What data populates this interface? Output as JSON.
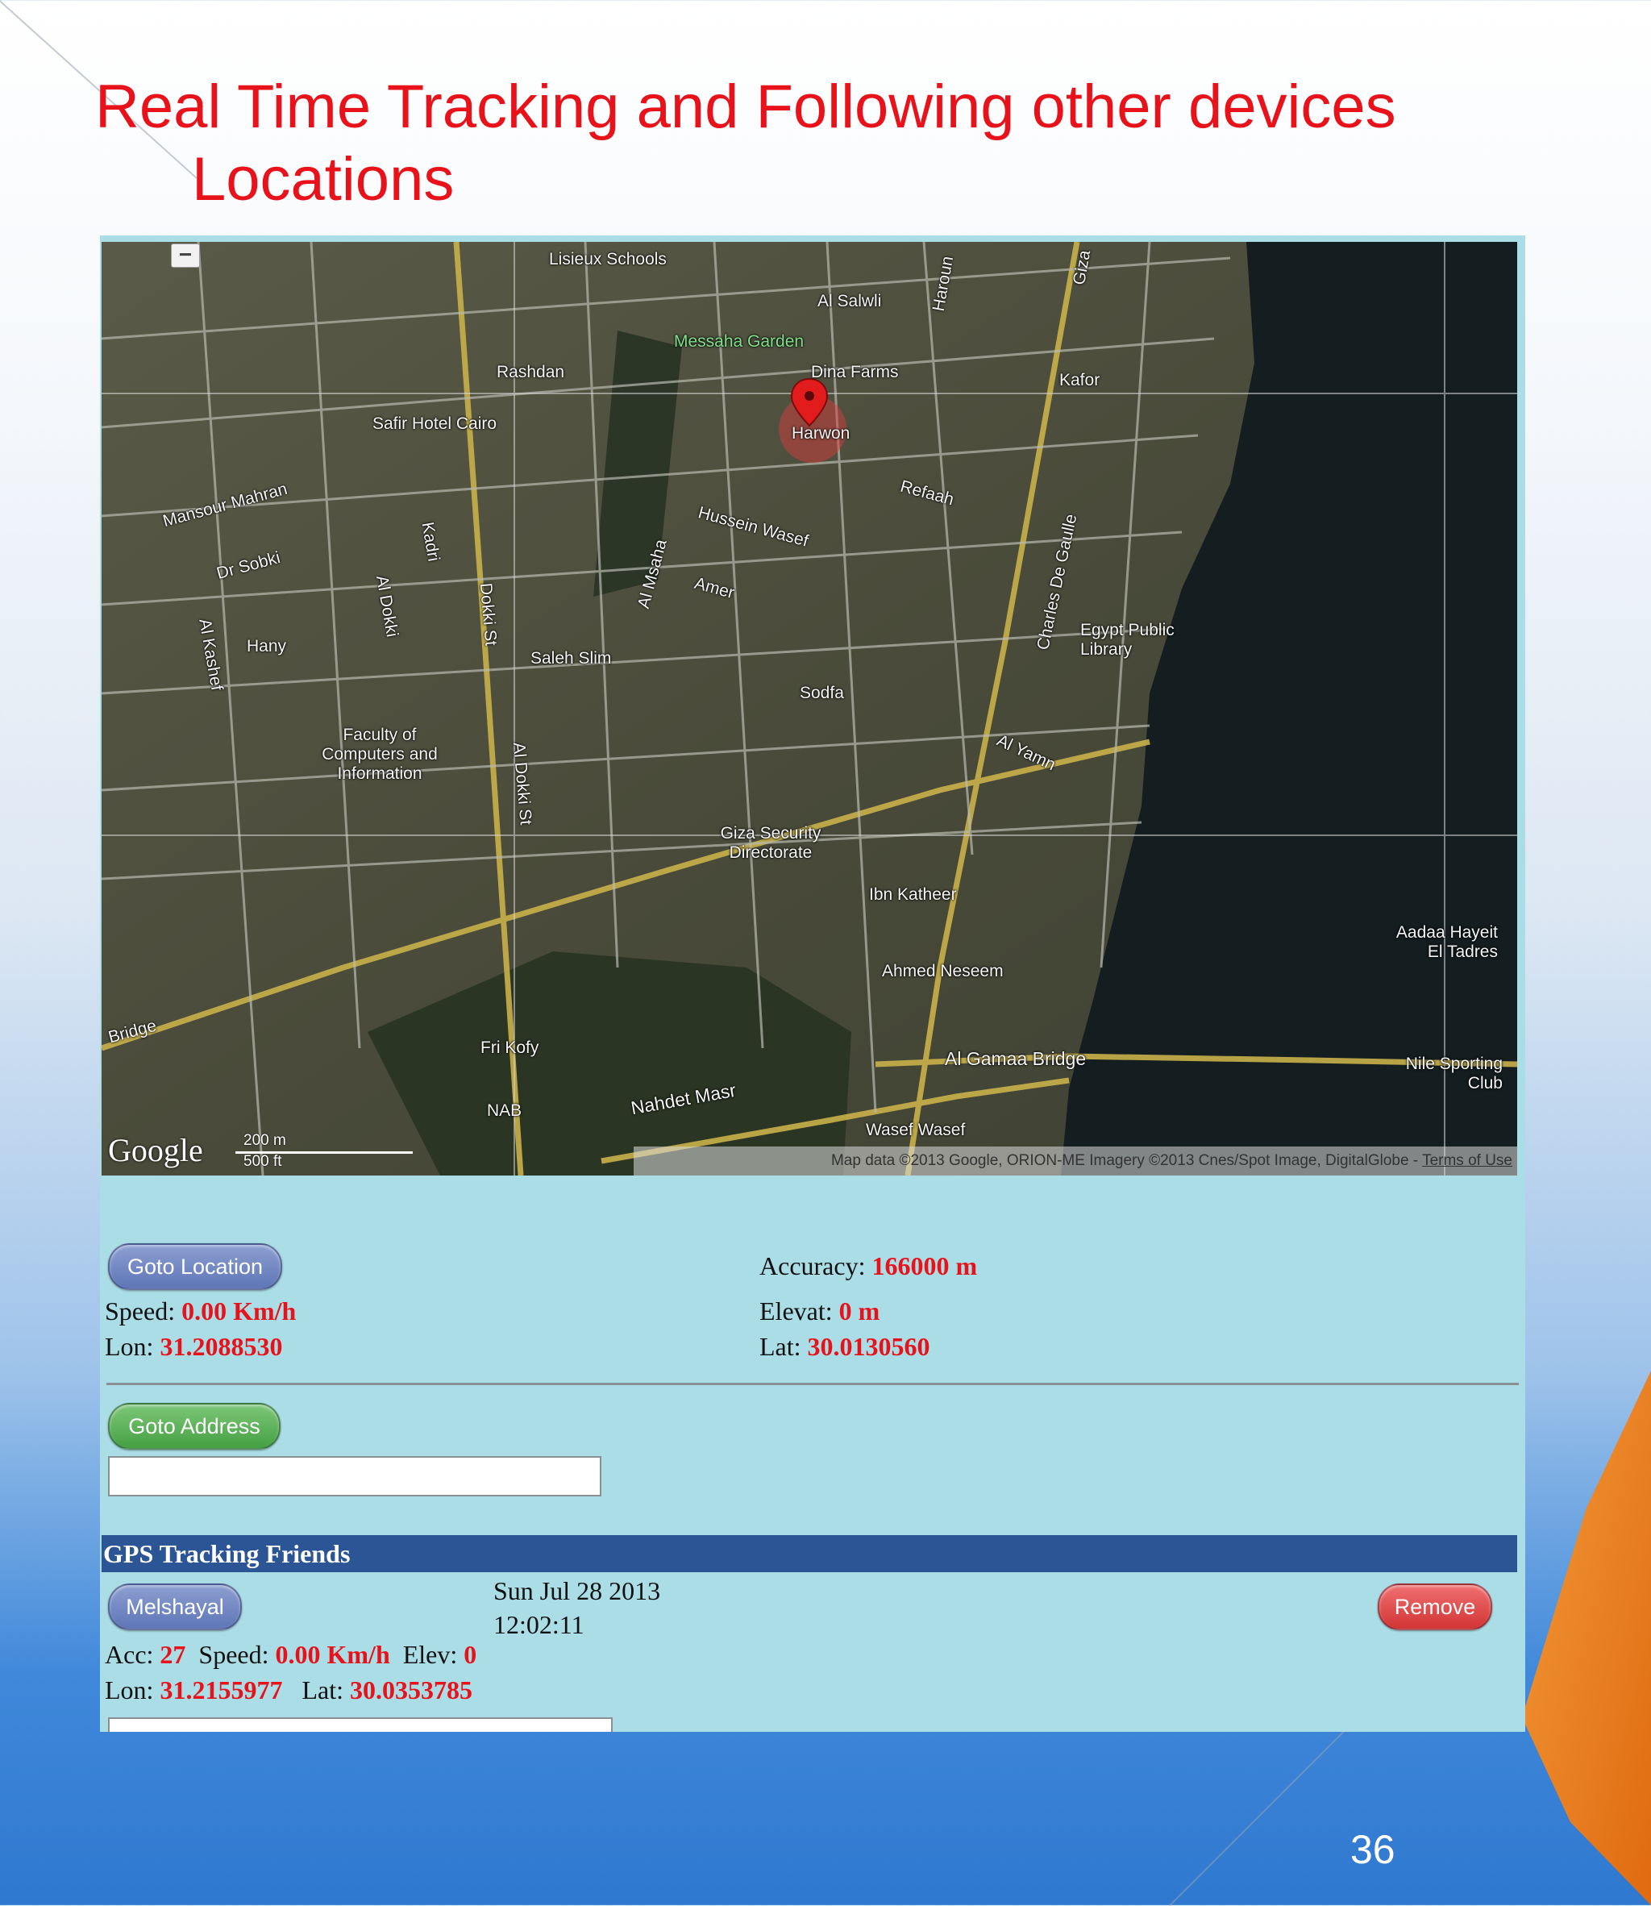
{
  "slide": {
    "title_line1": "Real Time Tracking and Following other devices",
    "title_line2": "Locations",
    "page_number": "36"
  },
  "map": {
    "zoom_out_label": "−",
    "labels": [
      "Lisieux Schools",
      "Al Salwli",
      "Haroun",
      "Giza",
      "Messaha Garden",
      "Rashdan",
      "Dina Farms",
      "Harwon",
      "Kafor",
      "Safir Hotel Cairo",
      "Mansour Mahran",
      "Dr Sobki",
      "Refaah",
      "Hussein Wasef",
      "Amer",
      "Al Msaha",
      "Al Dokki",
      "Kadri",
      "Dokki St",
      "Charles De Gaulle",
      "Egypt Public Library",
      "Hany",
      "Al Kashef",
      "Saleh Slim",
      "Sodfa",
      "Faculty of Computers and Information",
      "Al Dokki St",
      "Al Yamn",
      "Giza Security Directorate",
      "Ibn Katheer",
      "Ahmed Neseem",
      "Aadaa Hayeit El Tadres",
      "Bridge",
      "Fri Kofy",
      "Al Gamaa Bridge",
      "Nile Sporting Club",
      "NAB",
      "Nahdet Masr",
      "Wasef Wasef"
    ],
    "google_logo": "Google",
    "scale_metric": "200 m",
    "scale_imperial": "500 ft",
    "attribution": "Map data ©2013 Google, ORION-ME Imagery ©2013 Cnes/Spot Image, DigitalGlobe - ",
    "terms": "Terms of Use"
  },
  "location": {
    "goto_button": "Goto Location",
    "speed_label": "Speed:",
    "speed_value": "0.00 Km/h",
    "lon_label": "Lon:",
    "lon_value": "31.2088530",
    "accuracy_label": "Accuracy:",
    "accuracy_value": "166000 m",
    "elevat_label": "Elevat:",
    "elevat_value": "0 m",
    "lat_label": "Lat:",
    "lat_value": "30.0130560"
  },
  "address": {
    "goto_button": "Goto Address",
    "input_value": ""
  },
  "friends": {
    "header": "GPS Tracking Friends",
    "items": [
      {
        "name": "Melshayal",
        "date": "Sun Jul 28 2013",
        "time": "12:02:11",
        "acc_label": "Acc:",
        "acc_value": "27",
        "speed_label": "Speed:",
        "speed_value": "0.00 Km/h",
        "elev_label": "Elev:",
        "elev_value": "0",
        "lon_label": "Lon:",
        "lon_value": "31.2155977",
        "lat_label": "Lat:",
        "lat_value": "30.0353785",
        "remove_button": "Remove"
      }
    ]
  },
  "colors": {
    "title_red": "#e8121a",
    "value_red": "#e8121a",
    "panel_bg": "#aadde6",
    "header_blue": "#2c5596",
    "button_blue": "#6f85c2",
    "button_green": "#55b052",
    "button_red": "#e04848"
  }
}
